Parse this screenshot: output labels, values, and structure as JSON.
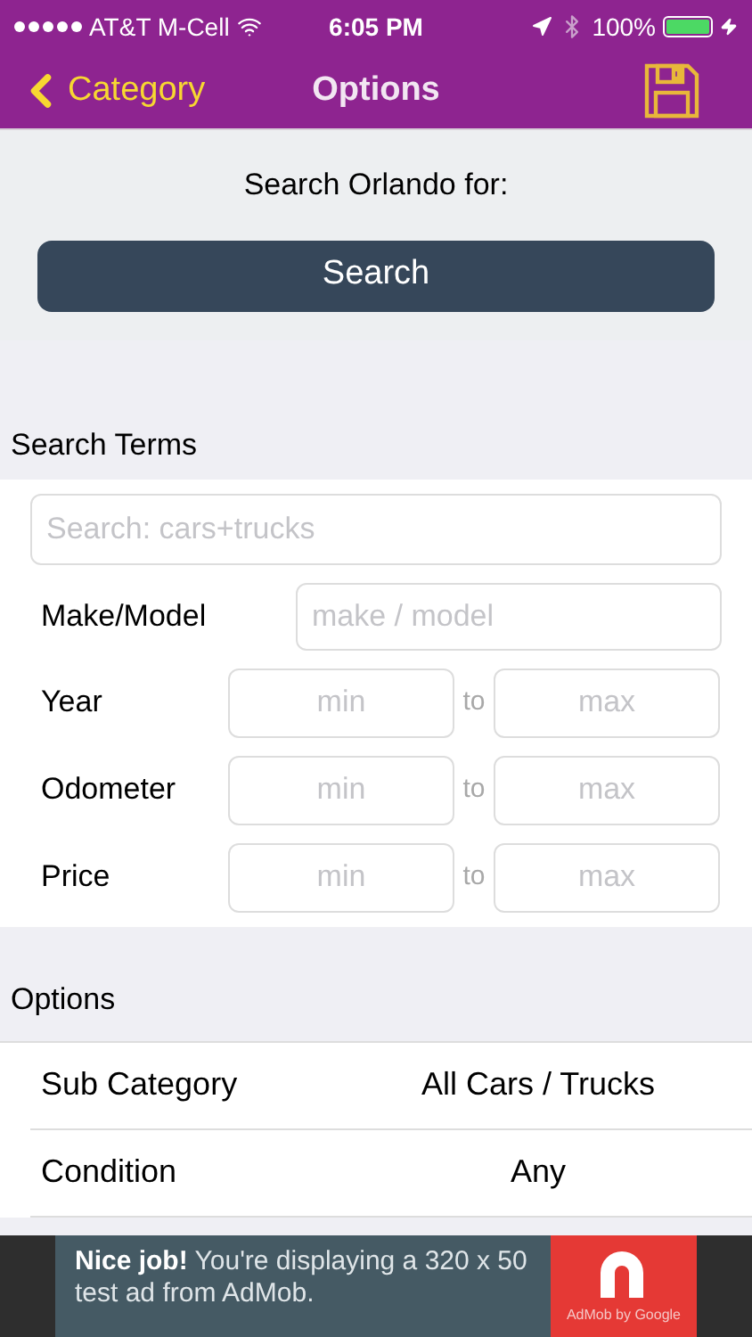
{
  "status_bar": {
    "carrier": "AT&T M-Cell",
    "time": "6:05 PM",
    "battery": "100%"
  },
  "nav": {
    "back": "Category",
    "title": "Options"
  },
  "search_header": {
    "label": "Search Orlando for:",
    "button": "Search"
  },
  "search_terms": {
    "title": "Search Terms",
    "query": {
      "placeholder": "Search: cars+trucks"
    },
    "make_model": {
      "label": "Make/Model",
      "placeholder": "make / model"
    },
    "ranges": [
      {
        "label": "Year",
        "min_placeholder": "min",
        "to": "to",
        "max_placeholder": "max"
      },
      {
        "label": "Odometer",
        "min_placeholder": "min",
        "to": "to",
        "max_placeholder": "max"
      },
      {
        "label": "Price",
        "min_placeholder": "min",
        "to": "to",
        "max_placeholder": "max"
      }
    ]
  },
  "options": {
    "title": "Options",
    "rows": [
      {
        "label": "Sub Category",
        "value": "All Cars / Trucks"
      },
      {
        "label": "Condition",
        "value": "Any"
      }
    ]
  },
  "ad": {
    "bold": "Nice job!",
    "text": "You're displaying a 320 x 50 test ad from AdMob.",
    "brand": "AdMob by Google"
  }
}
